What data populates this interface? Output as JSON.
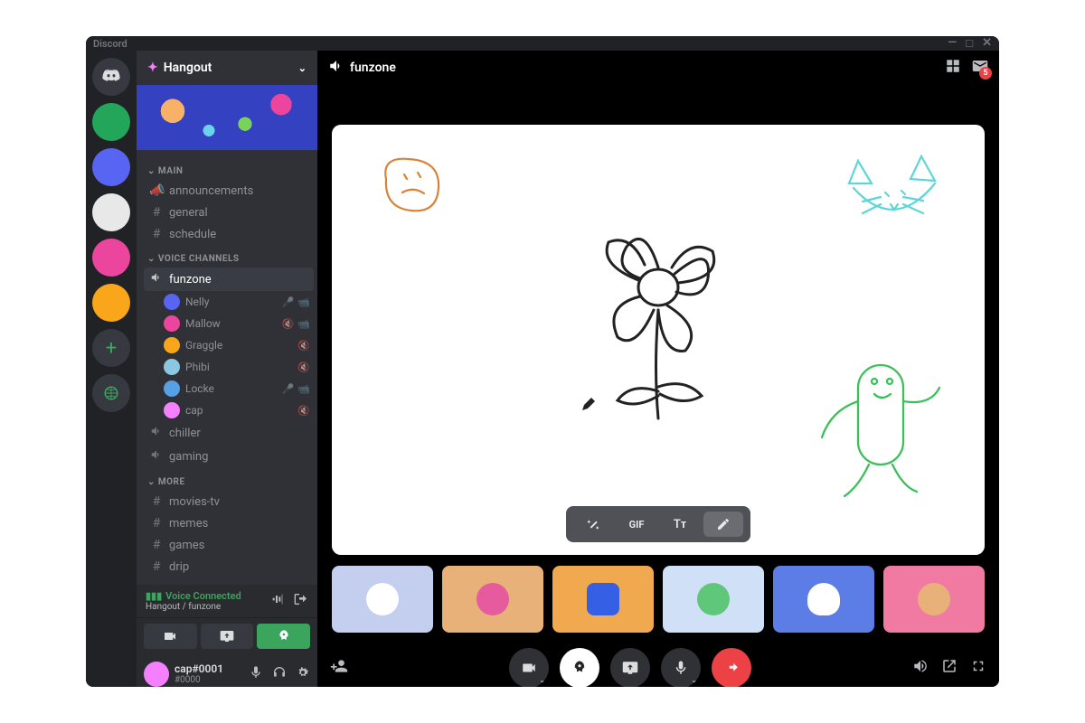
{
  "titlebar": {
    "app_name": "Discord"
  },
  "server": {
    "name": "Hangout"
  },
  "header": {
    "channel_name": "funzone",
    "inbox_count": "5"
  },
  "categories": {
    "main": "Main",
    "voice": "Voice Channels",
    "more": "More"
  },
  "text_channels": {
    "announcements": "announcements",
    "general": "general",
    "schedule": "schedule",
    "movies": "movies-tv",
    "memes": "memes",
    "games": "games",
    "drip": "drip"
  },
  "voice_channels": {
    "funzone": "funzone",
    "chiller": "chiller",
    "gaming": "gaming"
  },
  "members": [
    {
      "name": "Nelly",
      "mic": true,
      "cam": true
    },
    {
      "name": "Mallow",
      "mic_muted": true,
      "cam": true
    },
    {
      "name": "Graggle",
      "mic_muted": true
    },
    {
      "name": "Phibi",
      "mic_muted": true
    },
    {
      "name": "Locke",
      "mic": true,
      "cam": true
    },
    {
      "name": "cap",
      "mic_muted": true
    }
  ],
  "voice_panel": {
    "status": "Voice Connected",
    "sub": "Hangout / funzone"
  },
  "user": {
    "name": "cap#0001",
    "tag": "#0000"
  },
  "draw_toolbar": {
    "magic": "✦",
    "gif": "GIF",
    "text": "Tᴛ",
    "pencil": "✎"
  },
  "icons": {
    "speaker": "volume-icon",
    "hash": "hash-icon",
    "megaphone": "megaphone-icon",
    "chevron_down": "chevron-down-icon",
    "chevron_small": "chevron-right-icon"
  }
}
